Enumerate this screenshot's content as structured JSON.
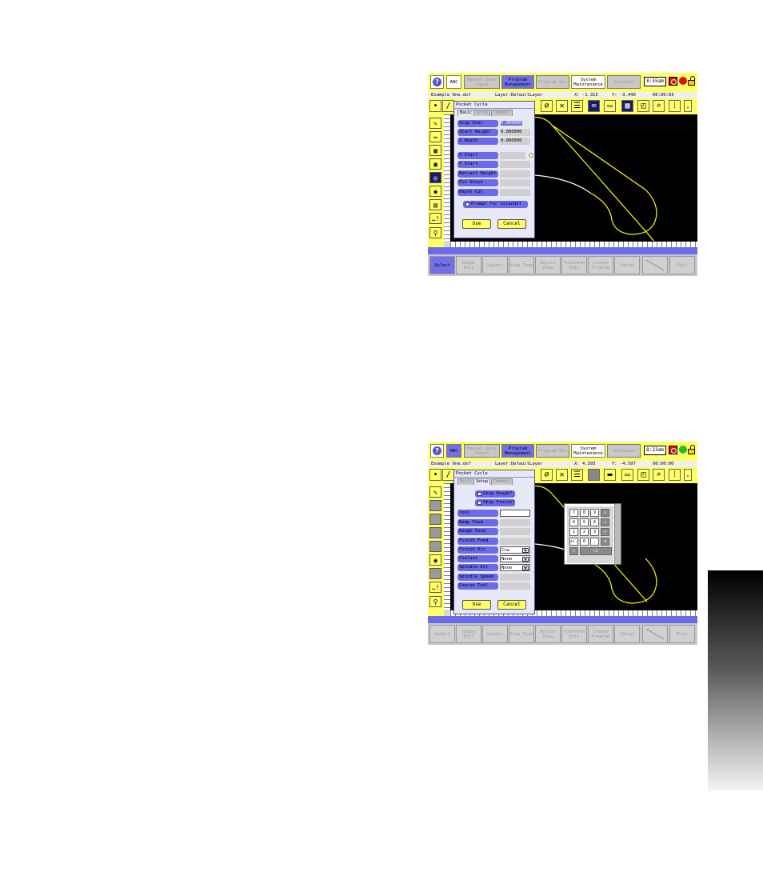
{
  "screens": [
    {
      "top": {
        "help_icon": "question-icon",
        "abc": "ABC",
        "manual_data_input": "Manual Data Input",
        "program_management": "Program Management",
        "program_run": "Program Run",
        "system_maintenance": "System Maintenance",
        "shutdown": "Shutdown",
        "clock": "8:55am"
      },
      "info": {
        "filename": "Example One.dxf",
        "layer": "Layer:DefaultLayer",
        "x": "X: -1.315",
        "y": "Y: -3.440",
        "timer": "00:00:03"
      },
      "dialog": {
        "title": "Pocket Cycle",
        "tabs": [
          "Basic",
          "Setup",
          "Comment"
        ],
        "fields": [
          {
            "label": "Step Over",
            "value": "0.000000"
          },
          {
            "label": "Start Height",
            "value": "0.000000"
          },
          {
            "label": "Z Depth",
            "value": "0.000000"
          },
          {
            "label": "X Start",
            "value": ""
          },
          {
            "label": "Y Start",
            "value": ""
          },
          {
            "label": "Retract Height",
            "value": ""
          },
          {
            "label": "Fin Stock",
            "value": ""
          },
          {
            "label": "Depth Cut",
            "value": ""
          }
        ],
        "checkbox": "Prompt for islands?",
        "use": "Use",
        "cancel": "Cancel"
      },
      "bottom": [
        "Select",
        "Shape Edit",
        "Layers",
        "View Type",
        "Adjust View",
        "ToolPath Edit",
        "Create Program",
        "Setup",
        "",
        "Exit"
      ]
    },
    {
      "top": {
        "help_icon": "question-icon",
        "abc": "ABC",
        "manual_data_input": "Manual Data Input",
        "program_management": "Program Management",
        "program_run": "Program Run",
        "system_maintenance": "System Maintenance",
        "shutdown": "Shutdown",
        "clock": "8:23am"
      },
      "info": {
        "filename": "Example One.dxf",
        "layer": "Layer:DefaultLayer",
        "x": "X: 4.393",
        "y": "Y: -4.597",
        "timer": "00:00:00"
      },
      "dialog": {
        "title": "Pocket Cycle",
        "tabs": [
          "Basic",
          "Setup",
          "Comment"
        ],
        "checkboxes": [
          "Skip Rough?",
          "Skip Finish?"
        ],
        "fields": [
          {
            "label": "Tool",
            "value": ""
          },
          {
            "label": "Ramp Feed",
            "value": ""
          },
          {
            "label": "Rough Feed",
            "value": ""
          },
          {
            "label": "Finish Feed",
            "value": ""
          },
          {
            "label": "Finish Dir",
            "value": "Ccw"
          },
          {
            "label": "Coolant",
            "value": "None"
          },
          {
            "label": "Spindle Dir",
            "value": "None"
          },
          {
            "label": "Spindle Speed",
            "value": ""
          },
          {
            "label": "Coarse Tool",
            "value": ""
          }
        ],
        "use": "Use",
        "cancel": "Cancel"
      },
      "keypad": {
        "keys": [
          "7",
          "8",
          "9",
          "4",
          "5",
          "6",
          "1",
          "2",
          "3",
          "+/-",
          "0",
          "."
        ]
      },
      "bottom": [
        "Select",
        "Shape Edit",
        "Layers",
        "View Type",
        "Adjust View",
        "ToolPath Edit",
        "Create Program",
        "Setup",
        "",
        "Exit"
      ]
    }
  ],
  "colors": {
    "accent_blue": "#6a6aea",
    "toolbar_yellow": "#ffff66",
    "canvas": "#000000",
    "path_yellow": "#ffff00",
    "status_red": "#e01010",
    "status_green": "#20c020"
  }
}
